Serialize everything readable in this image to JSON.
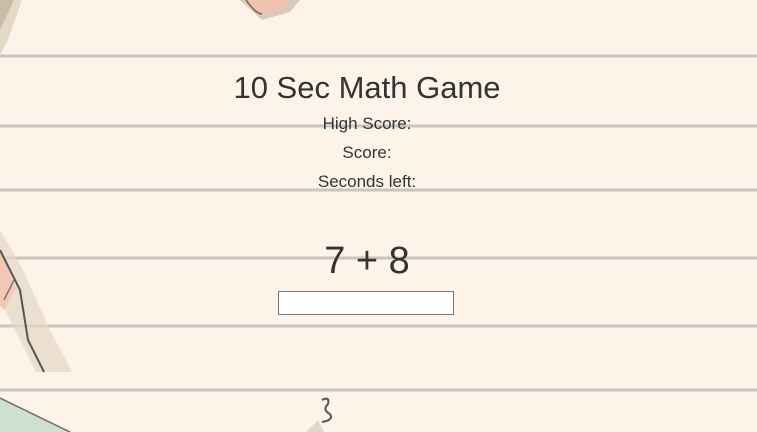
{
  "game": {
    "title": "10 Sec Math Game",
    "high_score_label": "High Score:",
    "high_score_value": "",
    "score_label": "Score:",
    "score_value": "",
    "seconds_left_label": "Seconds left:",
    "seconds_left_value": "",
    "problem": "7 + 8",
    "answer_value": ""
  },
  "colors": {
    "background": "#fdf3e8",
    "ruled_line": "#c9c6c1",
    "text": "#333333"
  }
}
